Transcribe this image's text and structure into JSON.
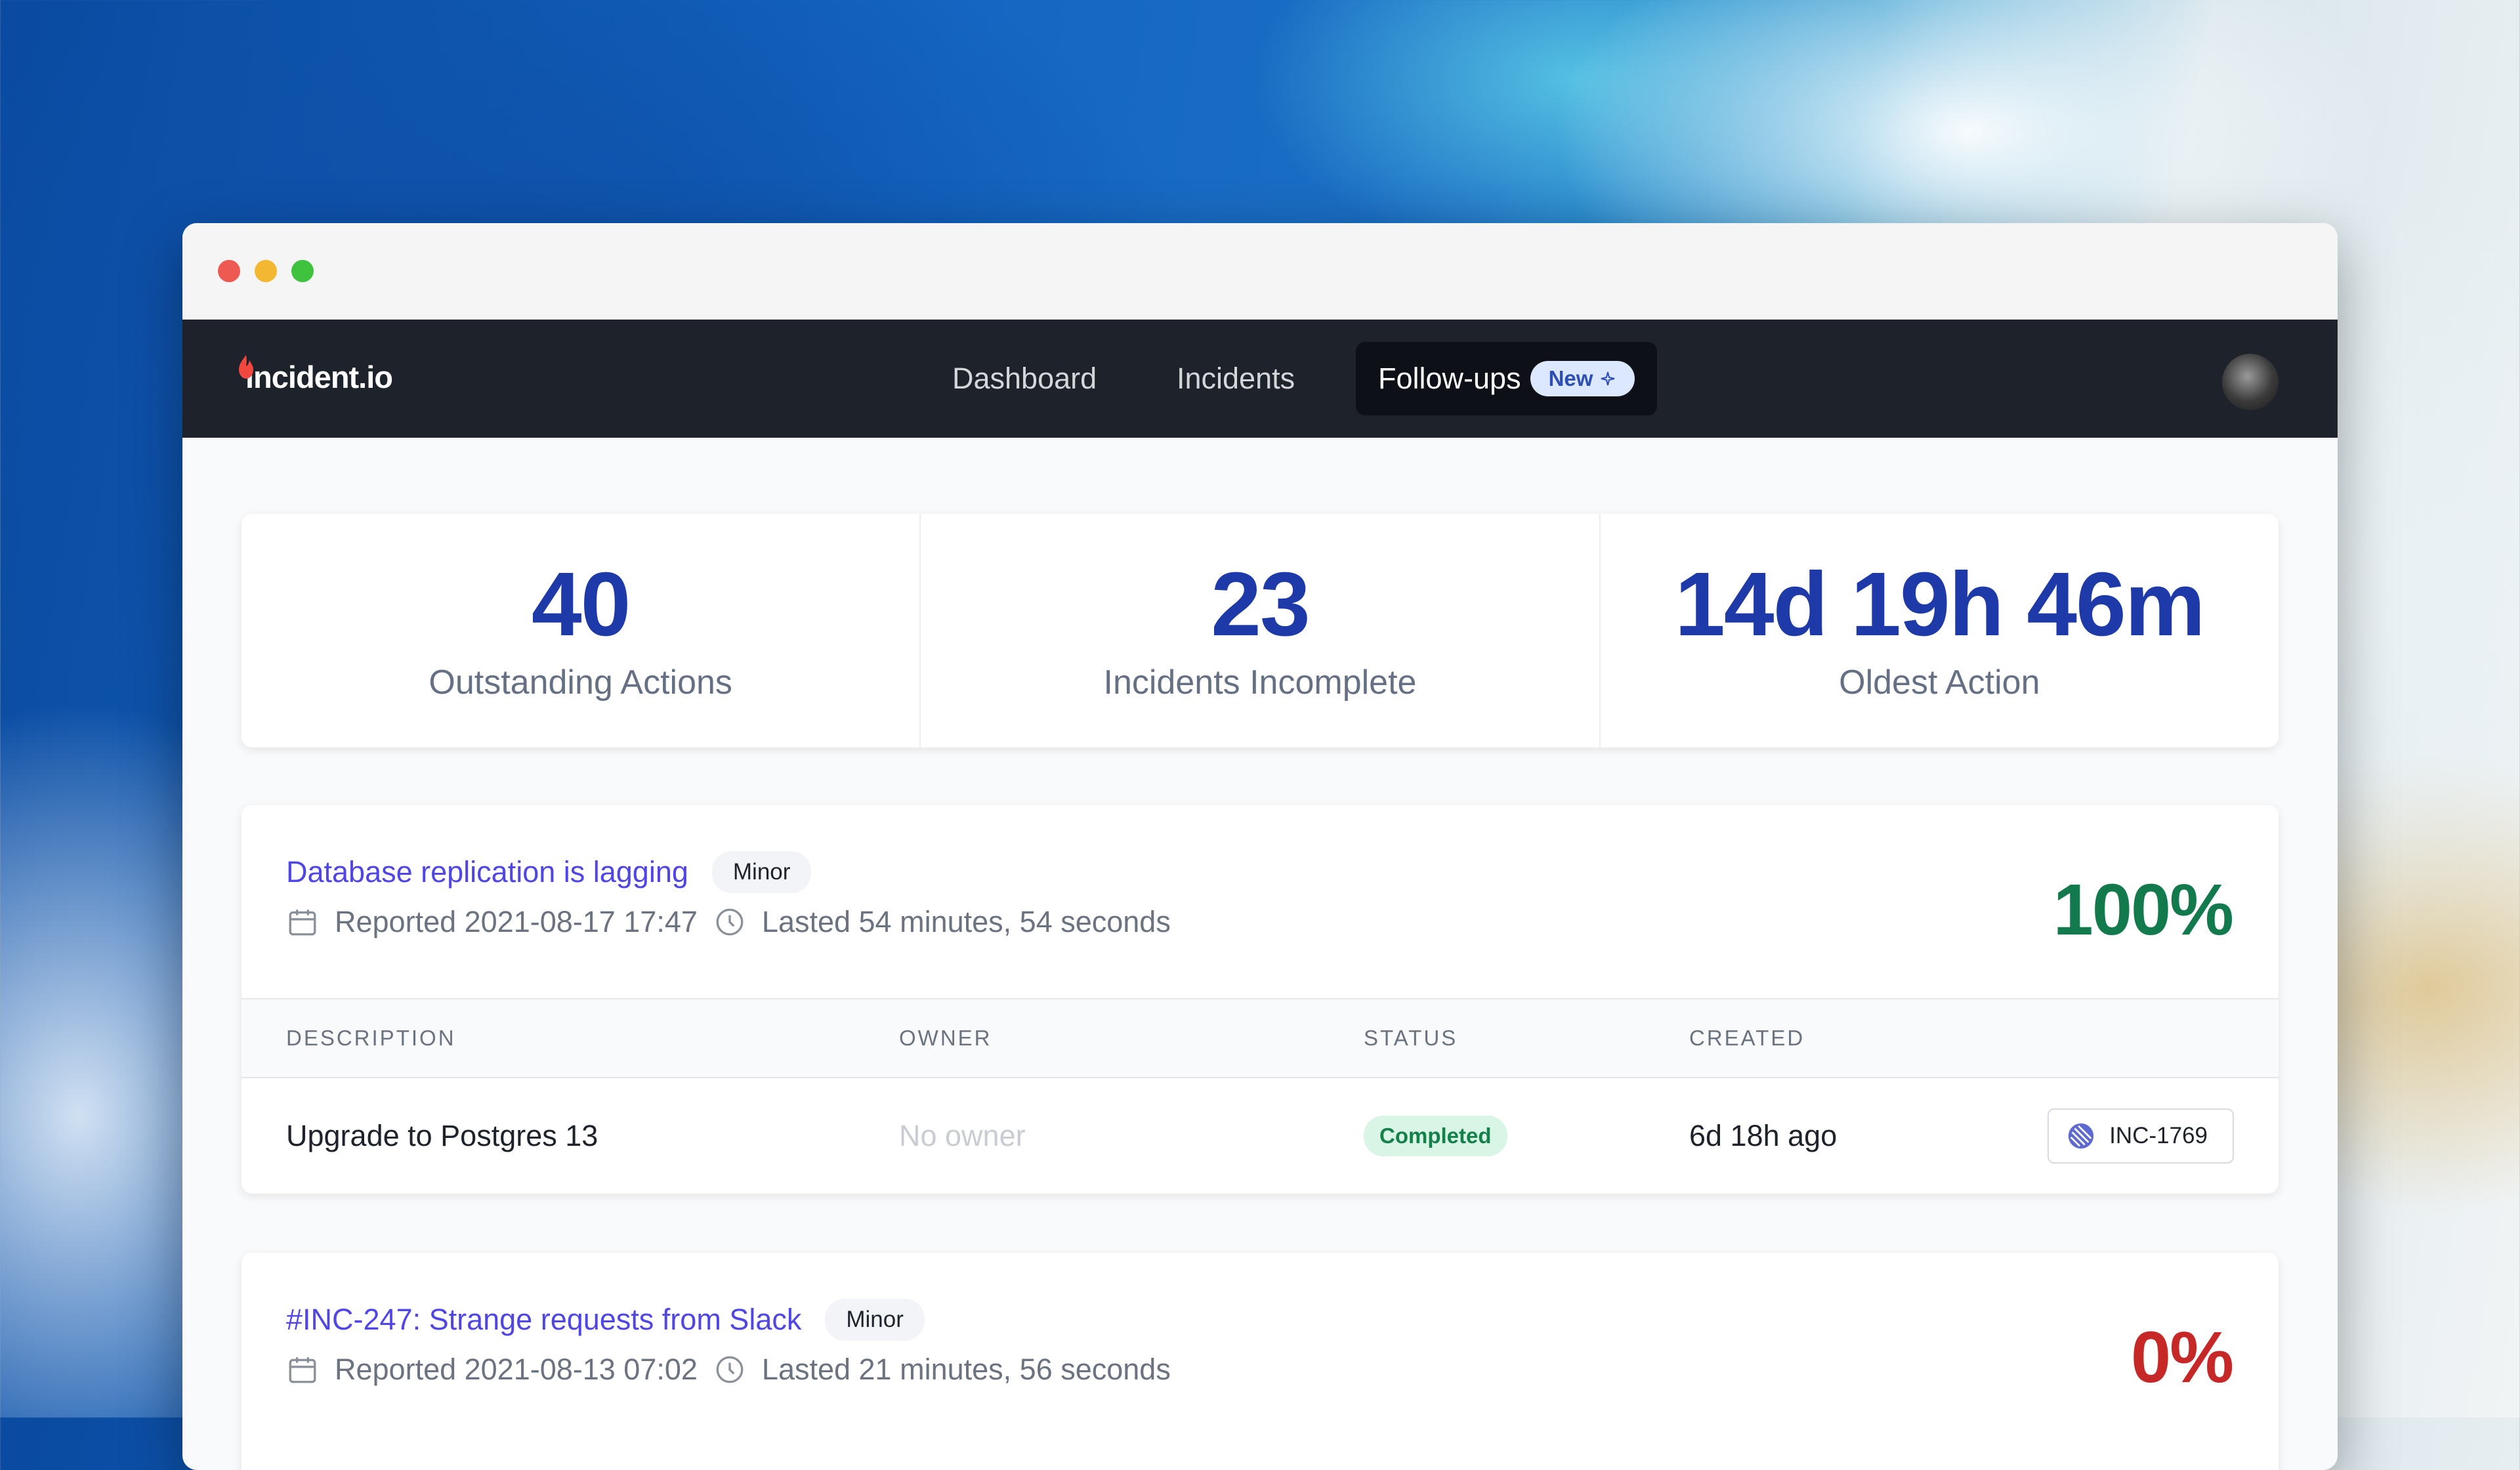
{
  "nav": {
    "logo": "incident.io",
    "items": [
      "Dashboard",
      "Incidents",
      "Follow-ups"
    ],
    "new_badge": "New"
  },
  "stats": [
    {
      "value": "40",
      "label": "Outstanding Actions"
    },
    {
      "value": "23",
      "label": "Incidents Incomplete"
    },
    {
      "value": "14d 19h 46m",
      "label": "Oldest Action"
    }
  ],
  "table_headers": [
    "DESCRIPTION",
    "OWNER",
    "STATUS",
    "CREATED"
  ],
  "incidents": [
    {
      "title": "Database replication is lagging",
      "severity": "Minor",
      "reported": "Reported 2021-08-17 17:47",
      "lasted": "Lasted 54 minutes, 54 seconds",
      "percent": "100%",
      "actions": [
        {
          "description": "Upgrade to Postgres 13",
          "owner": "No owner",
          "status": "Completed",
          "created": "6d 18h ago",
          "ref": "INC-1769"
        }
      ]
    },
    {
      "title": "#INC-247: Strange requests from Slack",
      "severity": "Minor",
      "reported": "Reported 2021-08-13 07:02",
      "lasted": "Lasted 21 minutes, 56 seconds",
      "percent": "0%"
    }
  ],
  "colors": {
    "nav_bg": "#1d222b",
    "stat_value": "#1e3aa8",
    "link": "#4f46e5",
    "success": "#137a4e",
    "danger": "#c62828"
  }
}
